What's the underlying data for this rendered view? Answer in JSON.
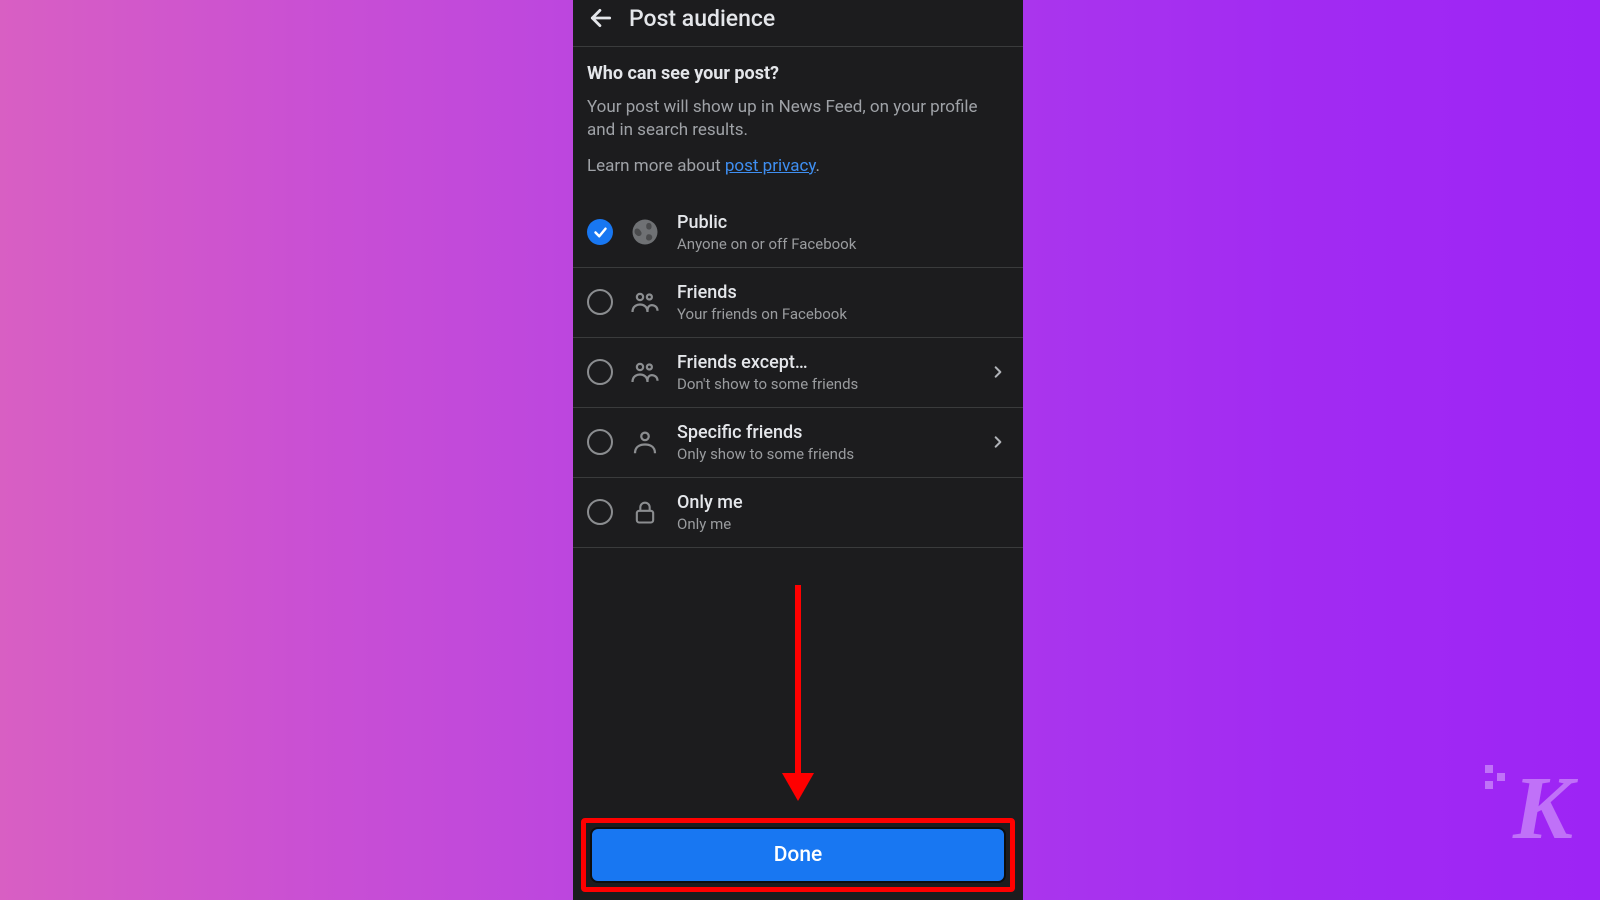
{
  "header": {
    "title": "Post audience"
  },
  "intro": {
    "heading": "Who can see your post?",
    "body": "Your post will show up in News Feed, on your profile and in search results.",
    "learn_prefix": "Learn more about ",
    "learn_link": "post privacy",
    "learn_suffix": "."
  },
  "options": [
    {
      "id": "public",
      "title": "Public",
      "sub": "Anyone on or off Facebook",
      "selected": true,
      "icon": "globe-icon",
      "chevron": false
    },
    {
      "id": "friends",
      "title": "Friends",
      "sub": "Your friends on Facebook",
      "selected": false,
      "icon": "people-icon",
      "chevron": false
    },
    {
      "id": "friends-except",
      "title": "Friends except…",
      "sub": "Don't show to some friends",
      "selected": false,
      "icon": "people-minus-icon",
      "chevron": true
    },
    {
      "id": "specific",
      "title": "Specific friends",
      "sub": "Only show to some friends",
      "selected": false,
      "icon": "person-icon",
      "chevron": true
    },
    {
      "id": "only-me",
      "title": "Only me",
      "sub": "Only me",
      "selected": false,
      "icon": "lock-icon",
      "chevron": false
    }
  ],
  "footer": {
    "done_label": "Done"
  },
  "annotation": {
    "arrow_target": "done-button",
    "highlight": "done-button"
  },
  "watermark": {
    "text": "K"
  },
  "colors": {
    "accent": "#1877f2",
    "highlight": "#ff0000",
    "bg_dark": "#1c1c1e"
  }
}
